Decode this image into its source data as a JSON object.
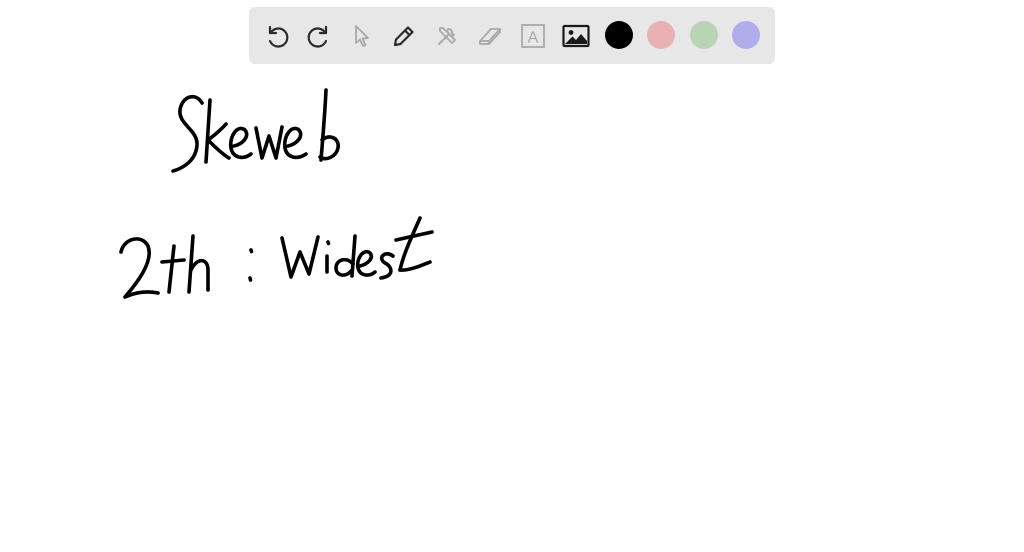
{
  "toolbar": {
    "tools": [
      {
        "name": "undo",
        "icon": "undo-icon"
      },
      {
        "name": "redo",
        "icon": "redo-icon"
      },
      {
        "name": "select",
        "icon": "cursor-icon"
      },
      {
        "name": "pen",
        "icon": "pencil-icon"
      },
      {
        "name": "tools",
        "icon": "tools-icon"
      },
      {
        "name": "eraser",
        "icon": "eraser-icon"
      },
      {
        "name": "text",
        "icon": "text-box-icon",
        "glyph": "A"
      },
      {
        "name": "image",
        "icon": "image-icon"
      }
    ],
    "colors": {
      "black": "#000000",
      "red": "#e9b1b4",
      "green": "#b9d3b7",
      "blue": "#b0aeea"
    },
    "icon_color": "#2b2b2b",
    "disabled_icon_color": "#a9a9a9",
    "background": "#e7e7e7"
  },
  "whiteboard": {
    "lines": [
      {
        "text": "Skeweb"
      },
      {
        "text": "2th : Widest"
      }
    ]
  }
}
